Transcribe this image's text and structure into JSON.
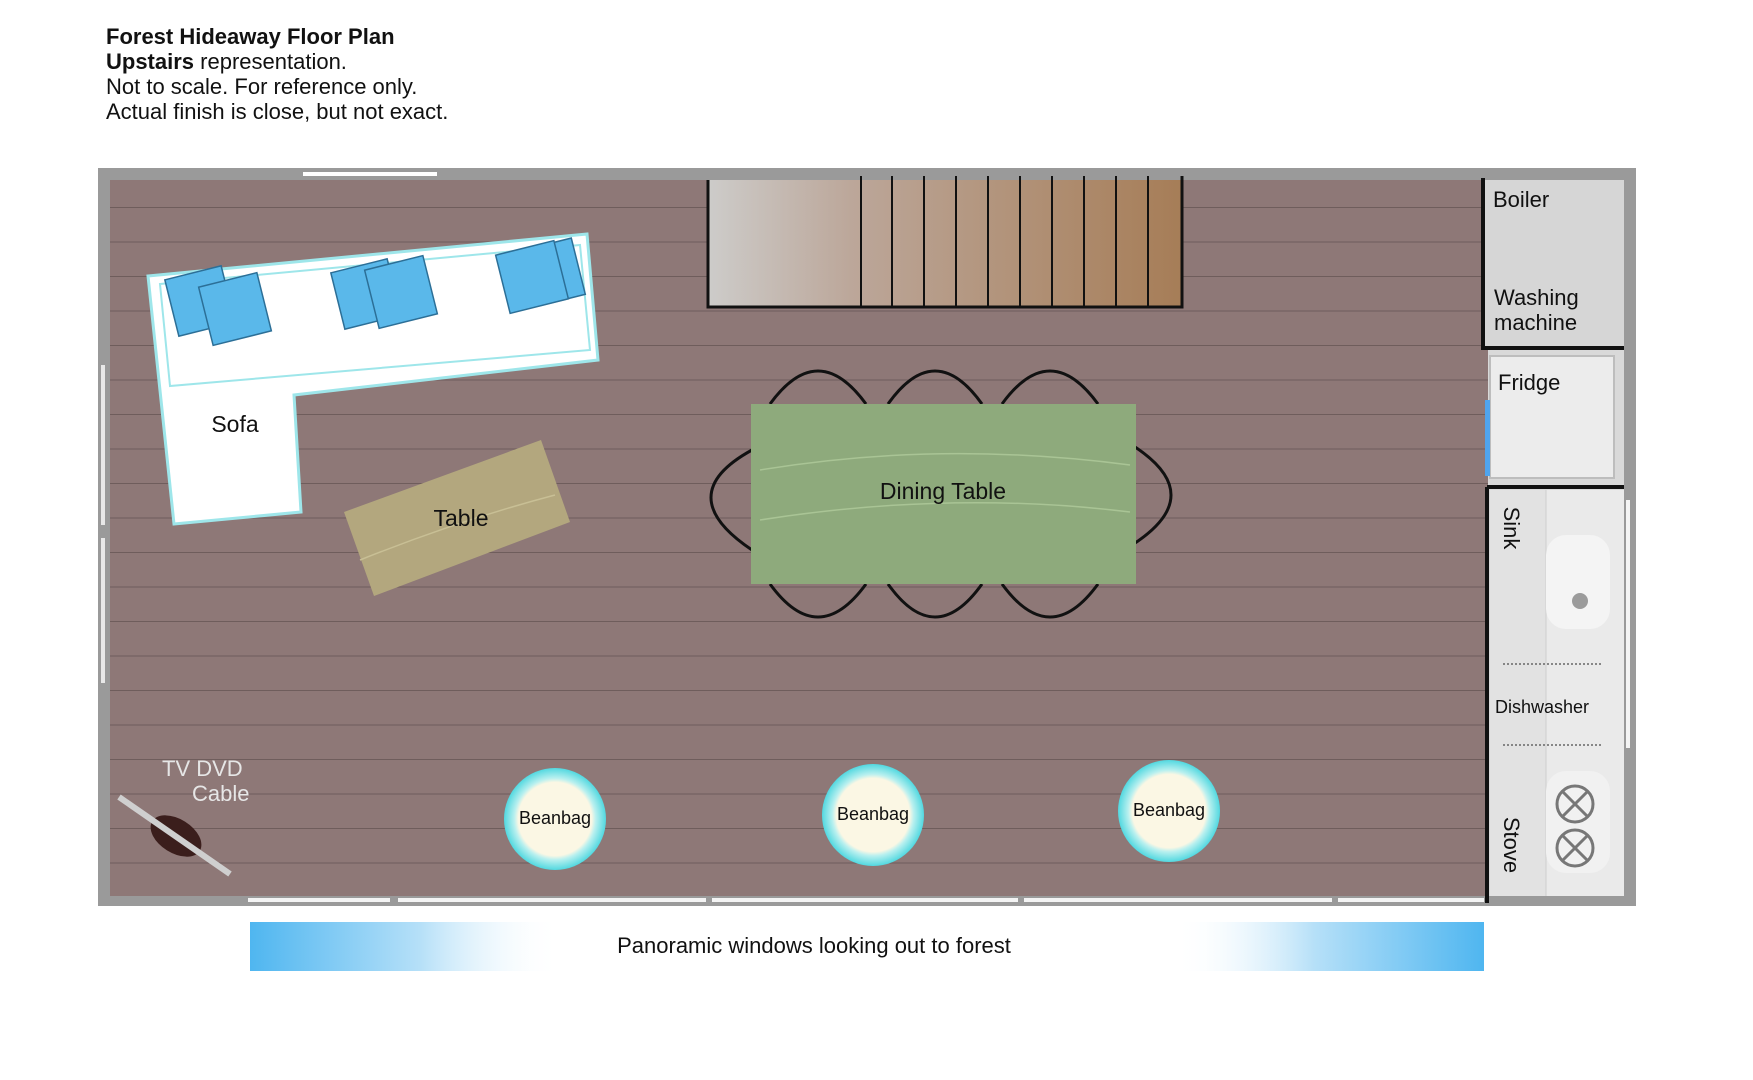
{
  "header": {
    "title": "Forest Hideaway Floor Plan",
    "line2_bold": "Upstairs",
    "line2_rest": " representation.",
    "line3": "Not to scale. For reference only.",
    "line4": "Actual finish is close, but not exact."
  },
  "rooms": {
    "sofa": "Sofa",
    "table": "Table",
    "dining_table": "Dining Table",
    "tv_line1": "TV DVD",
    "tv_line2": "Cable",
    "beanbags": [
      "Beanbag",
      "Beanbag",
      "Beanbag"
    ]
  },
  "utility": {
    "boiler": "Boiler",
    "washing_line1": "Washing",
    "washing_line2": "machine",
    "fridge": "Fridge",
    "sink": "Sink",
    "dishwasher": "Dishwasher",
    "stove": "Stove"
  },
  "windows_caption": "Panoramic windows looking out to forest",
  "colors": {
    "floor": "#8e7877",
    "wall": "#9a9a9a",
    "sofa": "#ffffff",
    "cushion": "#5ab8ea",
    "coffee_table": "#b3a77e",
    "dining_table": "#8eaa7c",
    "beanbag_ring": "#6fe0e6",
    "beanbag_fill": "#fbf7e4",
    "window_blue": "#4fb6f0"
  }
}
